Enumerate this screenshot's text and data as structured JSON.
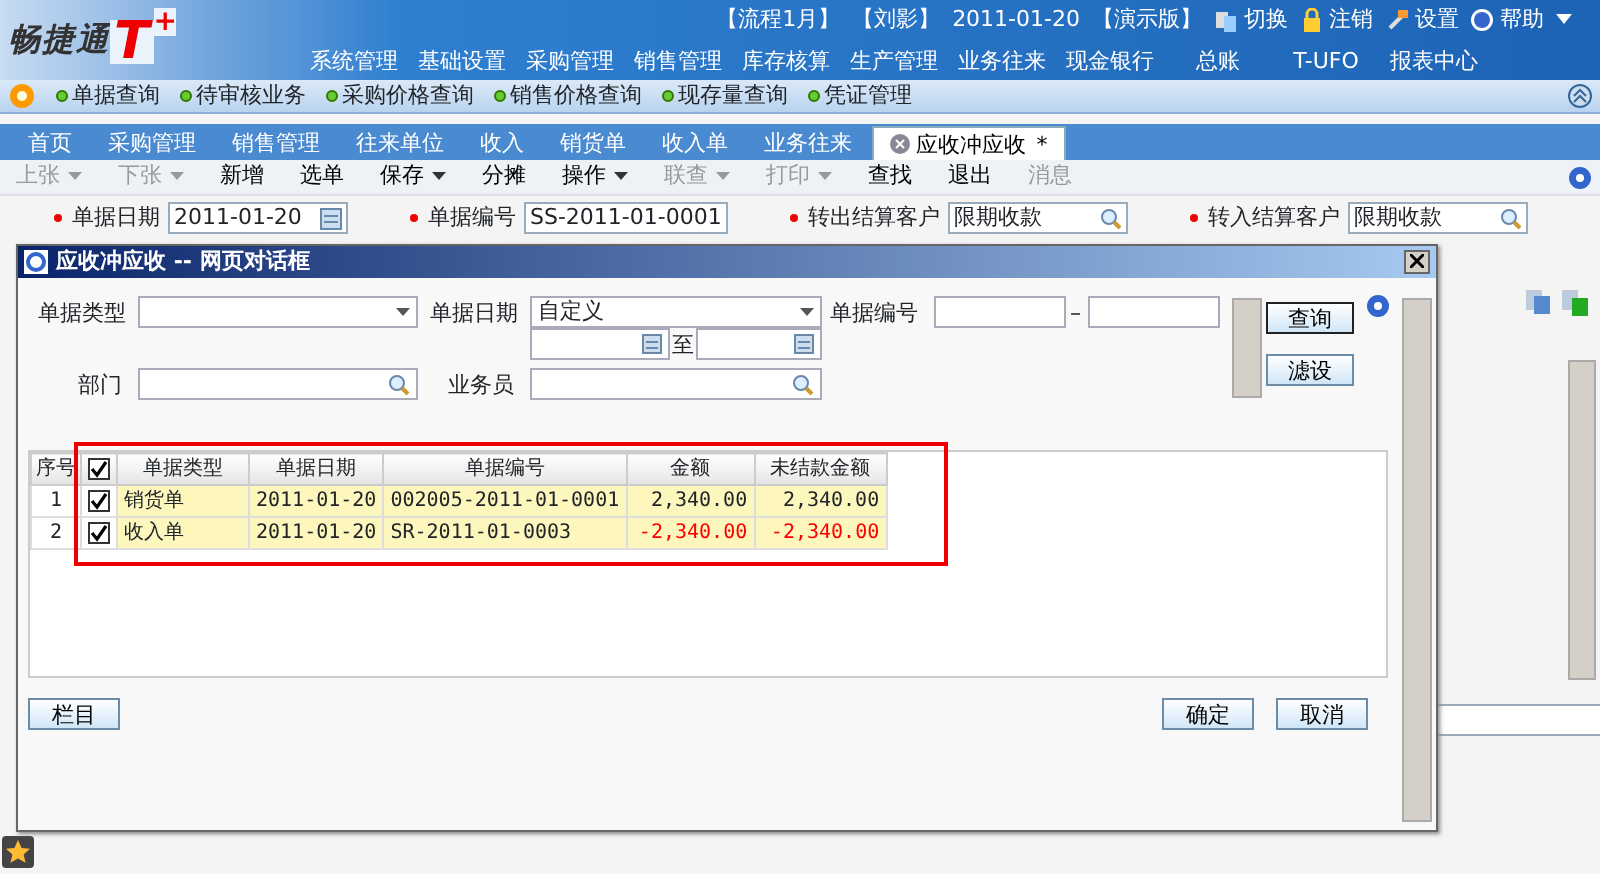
{
  "header": {
    "logo": "畅捷通",
    "logo_mark": "T",
    "logo_plus": "+",
    "info": [
      "【流程1月】",
      "【刘影】",
      "2011-01-20",
      "【演示版】"
    ],
    "actions": [
      {
        "label": "切换",
        "kind": "switch"
      },
      {
        "label": "注销",
        "kind": "lock"
      },
      {
        "label": "设置",
        "kind": "settings"
      },
      {
        "label": "帮助",
        "kind": "help"
      }
    ],
    "menu": [
      "系统管理",
      "基础设置",
      "采购管理",
      "销售管理",
      "库存核算",
      "生产管理",
      "业务往来",
      "现金银行",
      "总账",
      "T-UFO",
      "报表中心"
    ]
  },
  "shortcuts": [
    "单据查询",
    "待审核业务",
    "采购价格查询",
    "销售价格查询",
    "现存量查询",
    "凭证管理"
  ],
  "tabs": [
    {
      "label": "首页",
      "selected": false
    },
    {
      "label": "采购管理",
      "selected": false
    },
    {
      "label": "销售管理",
      "selected": false
    },
    {
      "label": "往来单位",
      "selected": false
    },
    {
      "label": "收入",
      "selected": false
    },
    {
      "label": "销货单",
      "selected": false
    },
    {
      "label": "收入单",
      "selected": false
    },
    {
      "label": "业务往来",
      "selected": false
    },
    {
      "label": "应收冲应收",
      "selected": true,
      "modified_mark": "*"
    }
  ],
  "toolbar": [
    {
      "label": "上张",
      "disabled": true,
      "dropdown": true
    },
    {
      "label": "下张",
      "disabled": true,
      "dropdown": true
    },
    {
      "label": "新增",
      "disabled": false,
      "dropdown": false
    },
    {
      "label": "选单",
      "disabled": false,
      "dropdown": false
    },
    {
      "label": "保存",
      "disabled": false,
      "dropdown": true
    },
    {
      "label": "分摊",
      "disabled": false,
      "dropdown": false
    },
    {
      "label": "操作",
      "disabled": false,
      "dropdown": true
    },
    {
      "label": "联查",
      "disabled": true,
      "dropdown": true
    },
    {
      "label": "打印",
      "disabled": true,
      "dropdown": true
    },
    {
      "label": "查找",
      "disabled": false,
      "dropdown": false
    },
    {
      "label": "退出",
      "disabled": false,
      "dropdown": false
    },
    {
      "label": "消息",
      "disabled": true,
      "dropdown": false
    }
  ],
  "form": [
    {
      "label": "单据日期",
      "value": "2011-01-20",
      "kind": "date",
      "required": true
    },
    {
      "label": "单据编号",
      "value": "SS-2011-01-0001",
      "kind": "text",
      "required": true
    },
    {
      "label": "转出结算客户",
      "value": "限期收款",
      "kind": "lookup",
      "required": true
    },
    {
      "label": "转入结算客户",
      "value": "限期收款",
      "kind": "lookup",
      "required": true
    }
  ],
  "dialog": {
    "title": "应收冲应收 -- 网页对话框",
    "filters": {
      "type_label": "单据类型",
      "date_label": "单据日期",
      "date_mode": "自定义",
      "date_to": "至",
      "number_label": "单据编号",
      "number_dash": "–",
      "dept_label": "部门",
      "staff_label": "业务员"
    },
    "query_buttons": [
      "查询",
      "滤设"
    ],
    "table": {
      "index_header": "序号",
      "columns": [
        "单据类型",
        "单据日期",
        "单据编号",
        "金额",
        "未结款金额"
      ],
      "all_checked": true,
      "rows": [
        {
          "index": "1",
          "checked": true,
          "negative": false,
          "cells": [
            "销货单",
            "2011-01-20",
            "002005-2011-01-0001",
            "2,340.00",
            "2,340.00"
          ]
        },
        {
          "index": "2",
          "checked": true,
          "negative": true,
          "cells": [
            "收入单",
            "2011-01-20",
            "SR-2011-01-0003",
            "-2,340.00",
            "-2,340.00"
          ]
        }
      ]
    },
    "left_buttons": [
      "栏目"
    ],
    "right_buttons": [
      "确定",
      "取消"
    ]
  }
}
